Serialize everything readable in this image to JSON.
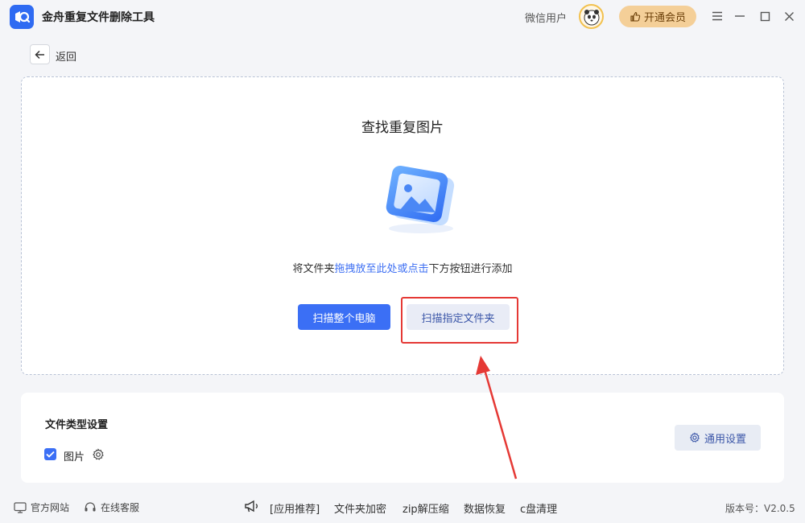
{
  "app": {
    "title": "金舟重复文件删除工具",
    "user_name": "微信用户",
    "vip_label": "开通会员"
  },
  "nav": {
    "back_label": "返回"
  },
  "dropzone": {
    "title": "查找重复图片",
    "hint_prefix": "将文件夹",
    "hint_link": "拖拽放至此处或点击",
    "hint_suffix": "下方按钮进行添加",
    "scan_all_label": "扫描整个电脑",
    "scan_folder_label": "扫描指定文件夹"
  },
  "settings": {
    "title": "文件类型设置",
    "file_type_label": "图片",
    "file_type_checked": true,
    "general_settings_label": "通用设置"
  },
  "footer": {
    "official_site": "官方网站",
    "online_service": "在线客服",
    "app_recommend": "[应用推荐]",
    "links": [
      "文件夹加密",
      "zip解压缩",
      "数据恢复",
      "c盘清理"
    ],
    "version": "版本号：V2.0.5"
  },
  "colors": {
    "primary": "#3b6ff5",
    "vip": "#f4cf98",
    "annotation": "#e53935"
  }
}
